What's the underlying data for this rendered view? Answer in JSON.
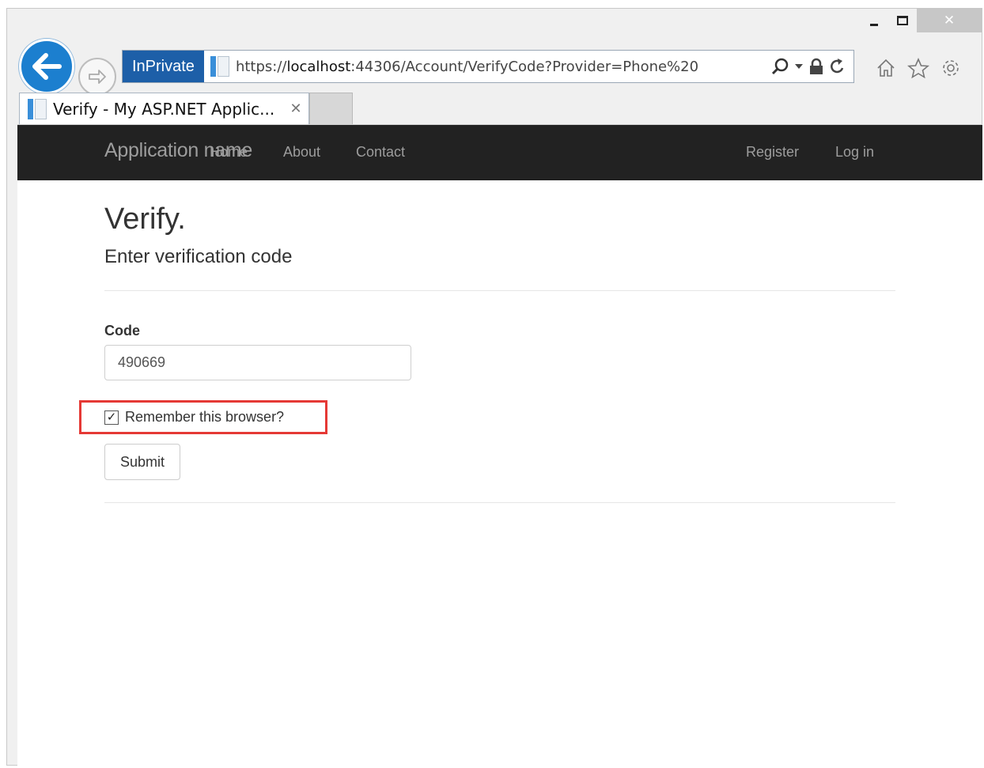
{
  "browser": {
    "mode_badge": "InPrivate",
    "url_prefix": "https://",
    "url_host": "localhost",
    "url_rest": ":44306/Account/VerifyCode?Provider=Phone%20",
    "tab_title": "Verify - My ASP.NET Applic...",
    "tab_close_glyph": "✕",
    "icons": [
      "back-arrow",
      "forward-arrow",
      "search",
      "dropdown",
      "lock",
      "refresh",
      "home",
      "favorites-star",
      "settings-gear"
    ],
    "window_close_glyph": "✕"
  },
  "site": {
    "brand": "Application name",
    "nav": [
      "Home",
      "About",
      "Contact"
    ],
    "nav_right": [
      "Register",
      "Log in"
    ]
  },
  "page": {
    "title": "Verify.",
    "subtitle": "Enter verification code",
    "code_label": "Code",
    "code_value": "490669",
    "remember_label": "Remember this browser?",
    "remember_checked": true,
    "submit_label": "Submit",
    "highlight_color": "#e53935"
  }
}
